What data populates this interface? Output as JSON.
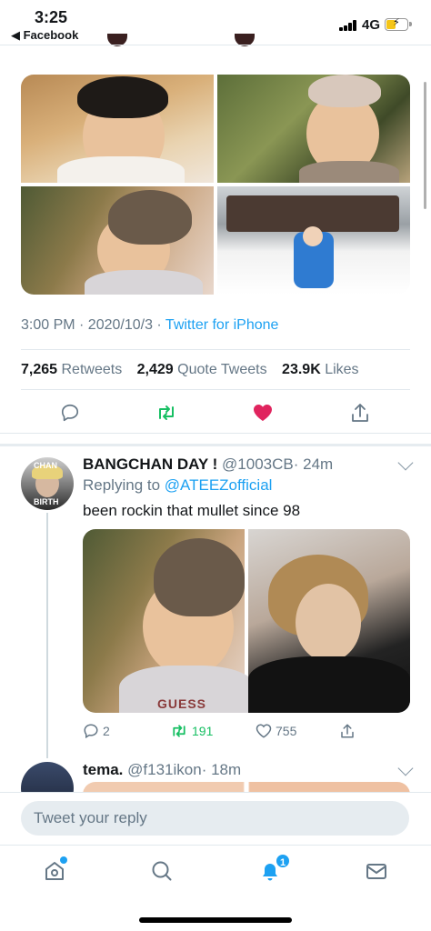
{
  "status_bar": {
    "time": "3:25",
    "back_app": "◀ Facebook",
    "network": "4G"
  },
  "tweet": {
    "timestamp": "3:00 PM · 2020/10/3 · ",
    "source": "Twitter for iPhone",
    "retweets_count": "7,265",
    "retweets_label": "Retweets",
    "quotes_count": "2,429",
    "quotes_label": "Quote Tweets",
    "likes_count": "23.9K",
    "likes_label": "Likes",
    "liked": true
  },
  "reply": {
    "display_name": "BANGCHAN DAY !",
    "handle": "@1003CB",
    "time": "· 24m",
    "avatar_text_top": "CHAN",
    "avatar_text_bottom": "BIRTH",
    "replying_label": "Replying to ",
    "replying_to": "@ATEEZofficial",
    "text": "been rockin that mullet since 98",
    "media_text": "GUESS",
    "reply_count": "2",
    "retweet_count": "191",
    "like_count": "755"
  },
  "next_reply": {
    "display_name": "tema.",
    "handle": "@f131ikon",
    "time": "· 18m"
  },
  "composer": {
    "placeholder": "Tweet your reply"
  },
  "tabbar": {
    "notifications_badge": "1"
  },
  "colors": {
    "accent": "#1da1f2",
    "like": "#e0245e",
    "retweet": "#17bf63",
    "muted": "#657786"
  }
}
